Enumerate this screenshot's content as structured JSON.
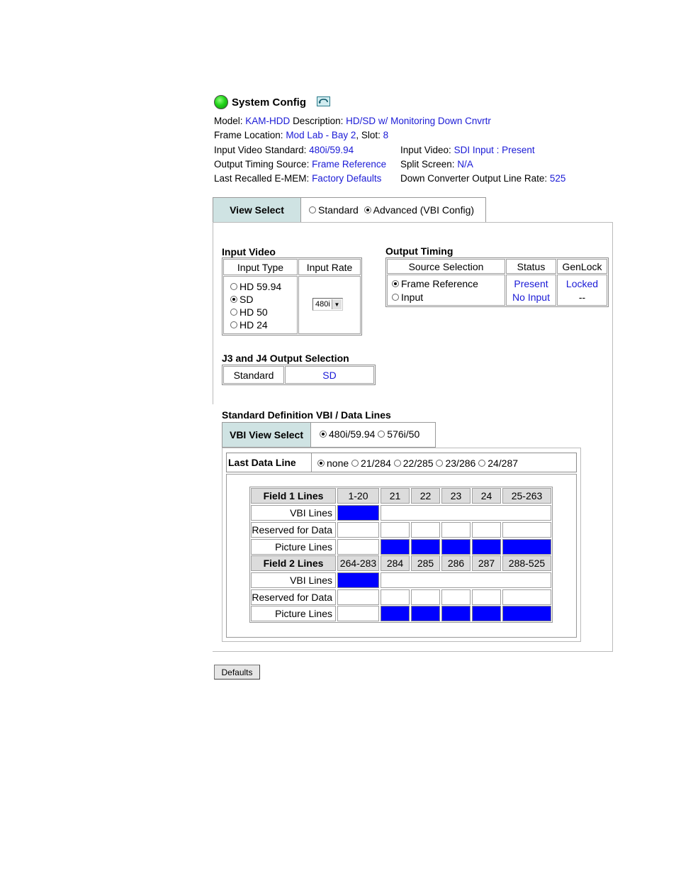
{
  "header": {
    "title": "System Config",
    "model_label": "Model:",
    "model_value": "KAM-HDD",
    "description_label": "Description:",
    "description_value": "HD/SD w/ Monitoring Down Cnvrtr",
    "frame_location_label": "Frame Location:",
    "frame_location_value": "Mod Lab - Bay 2",
    "slot_label": ", Slot:",
    "slot_value": "8",
    "input_video_standard_label": "Input Video Standard:",
    "input_video_standard_value": "480i/59.94",
    "input_video_label": "Input Video:",
    "input_video_value": "SDI Input : Present",
    "output_timing_source_label": "Output Timing Source:",
    "output_timing_source_value": "Frame Reference",
    "split_screen_label": "Split Screen:",
    "split_screen_value": "N/A",
    "last_recalled_label": "Last Recalled E-MEM:",
    "last_recalled_value": "Factory Defaults",
    "down_converter_label": "Down Converter Output Line Rate:",
    "down_converter_value": "525"
  },
  "view_select": {
    "label": "View Select",
    "options": [
      "Standard",
      "Advanced (VBI Config)"
    ],
    "selected": "Advanced (VBI Config)"
  },
  "input_video": {
    "title": "Input Video",
    "col_type": "Input Type",
    "col_rate": "Input Rate",
    "types": [
      "HD 59.94",
      "SD",
      "HD 50",
      "HD 24"
    ],
    "selected_type": "SD",
    "rate_value": "480i"
  },
  "output_timing": {
    "title": "Output Timing",
    "col_source": "Source Selection",
    "col_status": "Status",
    "col_genlock": "GenLock",
    "rows": [
      {
        "source": "Frame Reference",
        "status": "Present",
        "genlock": "Locked",
        "selected": true
      },
      {
        "source": "Input",
        "status": "No Input",
        "genlock": "--",
        "selected": false
      }
    ]
  },
  "j3j4": {
    "title": "J3 and J4 Output Selection",
    "label": "Standard",
    "value": "SD"
  },
  "vbi": {
    "title": "Standard Definition VBI / Data Lines",
    "view_select_label": "VBI View Select",
    "view_options": [
      "480i/59.94",
      "576i/50"
    ],
    "view_selected": "480i/59.94",
    "last_data_line_label": "Last Data Line",
    "last_data_options": [
      "none",
      "21/284",
      "22/285",
      "23/286",
      "24/287"
    ],
    "last_data_selected": "none",
    "field1": {
      "label": "Field 1 Lines",
      "columns": [
        "1-20",
        "21",
        "22",
        "23",
        "24",
        "25-263"
      ]
    },
    "field2": {
      "label": "Field 2 Lines",
      "columns": [
        "264-283",
        "284",
        "285",
        "286",
        "287",
        "288-525"
      ]
    },
    "row_labels": [
      "VBI Lines",
      "Reserved for Data",
      "Picture Lines"
    ],
    "fill_color": "#0000ff"
  },
  "buttons": {
    "defaults": "Defaults"
  }
}
